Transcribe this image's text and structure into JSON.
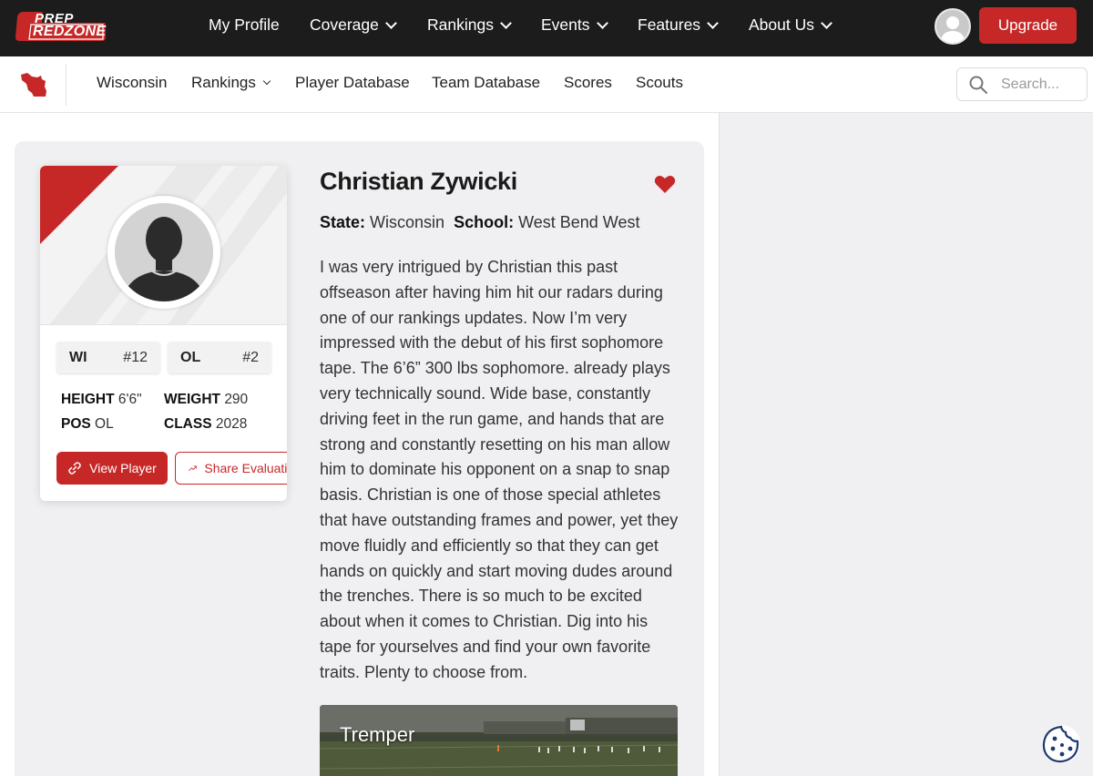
{
  "brand": {
    "logo_line1": "PREP",
    "logo_line2": "REDZONE",
    "accent_color": "#c62828",
    "topbar_color": "#1c1c1c"
  },
  "top_nav": {
    "items": [
      {
        "label": "My Profile",
        "dropdown": false
      },
      {
        "label": "Coverage",
        "dropdown": true
      },
      {
        "label": "Rankings",
        "dropdown": true
      },
      {
        "label": "Events",
        "dropdown": true
      },
      {
        "label": "Features",
        "dropdown": true
      },
      {
        "label": "About Us",
        "dropdown": true
      }
    ],
    "upgrade_label": "Upgrade"
  },
  "sub_nav": {
    "items": [
      {
        "label": "Wisconsin",
        "dropdown": false
      },
      {
        "label": "Rankings",
        "dropdown": true
      },
      {
        "label": "Player Database",
        "dropdown": false
      },
      {
        "label": "Team Database",
        "dropdown": false
      },
      {
        "label": "Scores",
        "dropdown": false
      },
      {
        "label": "Scouts",
        "dropdown": false
      }
    ],
    "search_placeholder": "Search..."
  },
  "player_card": {
    "state_abbr": "WI",
    "state_rank": "#12",
    "position_abbr": "OL",
    "position_rank": "#2",
    "height_label": "HEIGHT",
    "height_value": "6'6\"",
    "weight_label": "WEIGHT",
    "weight_value": "290",
    "pos_label": "POS",
    "pos_value": "OL",
    "class_label": "CLASS",
    "class_value": "2028",
    "view_button": "View Player",
    "share_button": "Share Evaluation"
  },
  "evaluation": {
    "player_name": "Christian Zywicki",
    "state_label": "State:",
    "state_value": "Wisconsin",
    "school_label": "School:",
    "school_value": "West Bend West",
    "body": "I was very intrigued by Christian this past offseason after having him hit our radars during one of our rankings updates. Now I’m very impressed with the debut of his first sophomore tape. The 6’6” 300 lbs sophomore. already plays very technically sound. Wide base, constantly driving feet in the run game, and hands that are strong and constantly resetting on his man allow him to dominate his opponent on a snap to snap basis. Christian is one of those special athletes that have outstanding frames and power, yet they move fluidly and efficiently so that they can get hands on quickly and start moving dudes around the trenches. There is so much to be excited about when it comes to Christian. Dig into his tape for yourselves and find your own favorite traits. Plenty to choose from.",
    "video_title": "Tremper"
  }
}
